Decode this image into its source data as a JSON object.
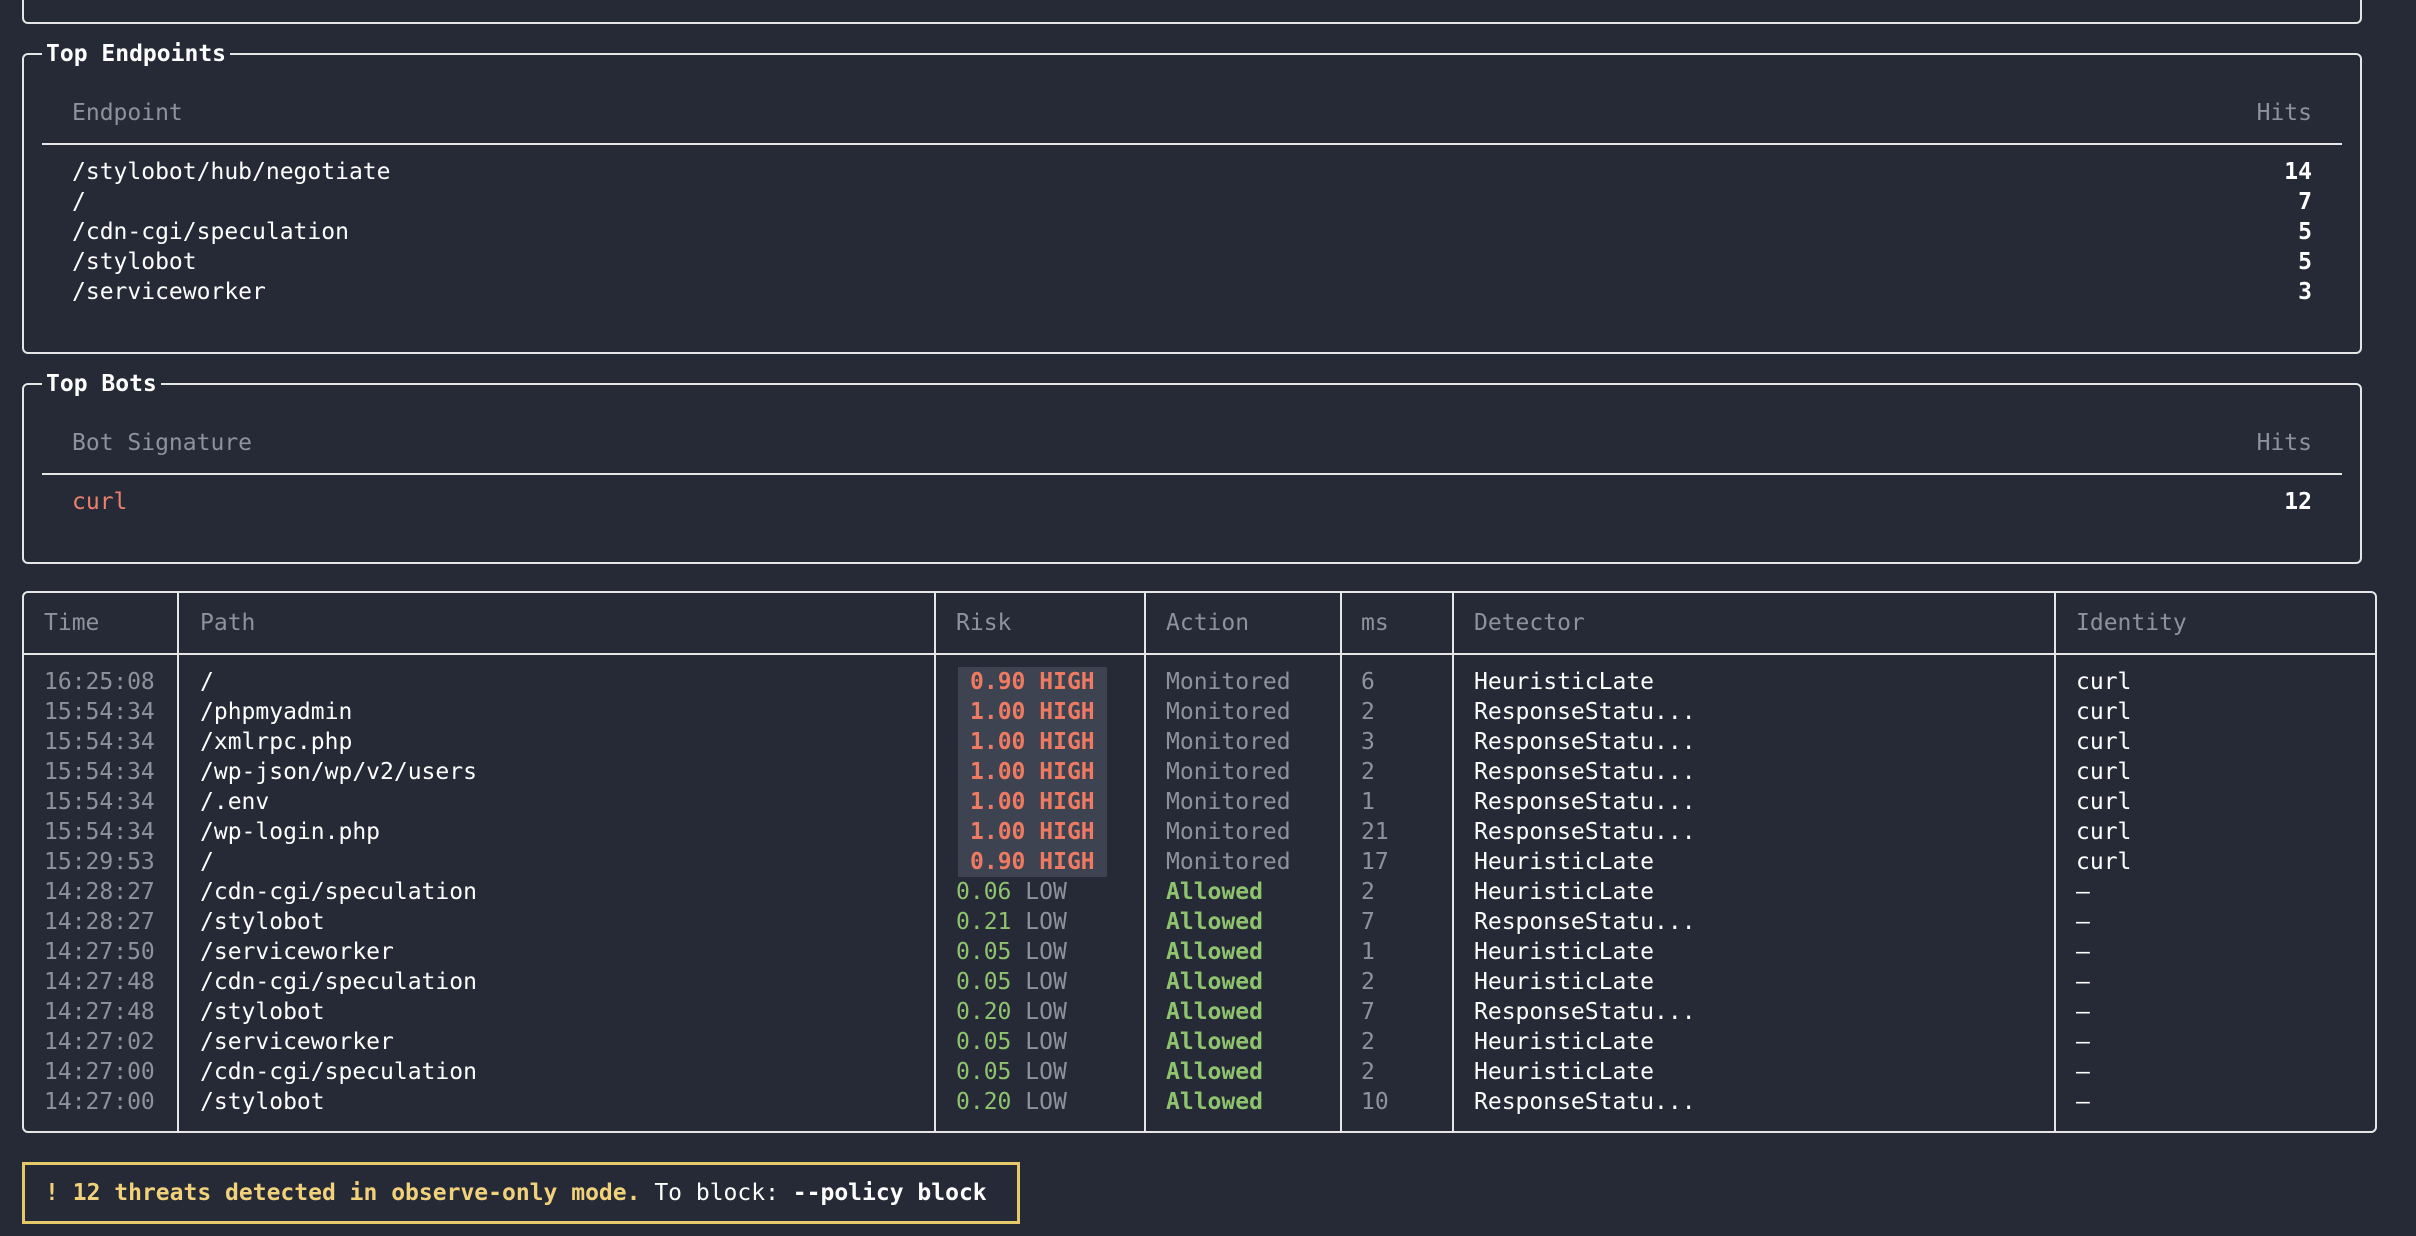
{
  "top_endpoints": {
    "title": "Top Endpoints",
    "col_endpoint": "Endpoint",
    "col_hits": "Hits",
    "rows": [
      {
        "endpoint": "/stylobot/hub/negotiate",
        "hits": "14"
      },
      {
        "endpoint": "/",
        "hits": "7"
      },
      {
        "endpoint": "/cdn-cgi/speculation",
        "hits": "5"
      },
      {
        "endpoint": "/stylobot",
        "hits": "5"
      },
      {
        "endpoint": "/serviceworker",
        "hits": "3"
      }
    ]
  },
  "top_bots": {
    "title": "Top Bots",
    "col_signature": "Bot Signature",
    "col_hits": "Hits",
    "rows": [
      {
        "signature": "curl",
        "hits": "12"
      }
    ]
  },
  "live_table": {
    "headers": {
      "time": "Time",
      "path": "Path",
      "risk": "Risk",
      "action": "Action",
      "ms": "ms",
      "detector": "Detector",
      "identity": "Identity"
    },
    "rows": [
      {
        "time": "16:25:08",
        "path": "/",
        "risk": "0.90",
        "level": "HIGH",
        "action": "Monitored",
        "ms": "6",
        "detector": "HeuristicLate",
        "identity": "curl"
      },
      {
        "time": "15:54:34",
        "path": "/phpmyadmin",
        "risk": "1.00",
        "level": "HIGH",
        "action": "Monitored",
        "ms": "2",
        "detector": "ResponseStatu...",
        "identity": "curl"
      },
      {
        "time": "15:54:34",
        "path": "/xmlrpc.php",
        "risk": "1.00",
        "level": "HIGH",
        "action": "Monitored",
        "ms": "3",
        "detector": "ResponseStatu...",
        "identity": "curl"
      },
      {
        "time": "15:54:34",
        "path": "/wp-json/wp/v2/users",
        "risk": "1.00",
        "level": "HIGH",
        "action": "Monitored",
        "ms": "2",
        "detector": "ResponseStatu...",
        "identity": "curl"
      },
      {
        "time": "15:54:34",
        "path": "/.env",
        "risk": "1.00",
        "level": "HIGH",
        "action": "Monitored",
        "ms": "1",
        "detector": "ResponseStatu...",
        "identity": "curl"
      },
      {
        "time": "15:54:34",
        "path": "/wp-login.php",
        "risk": "1.00",
        "level": "HIGH",
        "action": "Monitored",
        "ms": "21",
        "detector": "ResponseStatu...",
        "identity": "curl"
      },
      {
        "time": "15:29:53",
        "path": "/",
        "risk": "0.90",
        "level": "HIGH",
        "action": "Monitored",
        "ms": "17",
        "detector": "HeuristicLate",
        "identity": "curl"
      },
      {
        "time": "14:28:27",
        "path": "/cdn-cgi/speculation",
        "risk": "0.06",
        "level": "LOW",
        "action": "Allowed",
        "ms": "2",
        "detector": "HeuristicLate",
        "identity": "–"
      },
      {
        "time": "14:28:27",
        "path": "/stylobot",
        "risk": "0.21",
        "level": "LOW",
        "action": "Allowed",
        "ms": "7",
        "detector": "ResponseStatu...",
        "identity": "–"
      },
      {
        "time": "14:27:50",
        "path": "/serviceworker",
        "risk": "0.05",
        "level": "LOW",
        "action": "Allowed",
        "ms": "1",
        "detector": "HeuristicLate",
        "identity": "–"
      },
      {
        "time": "14:27:48",
        "path": "/cdn-cgi/speculation",
        "risk": "0.05",
        "level": "LOW",
        "action": "Allowed",
        "ms": "2",
        "detector": "HeuristicLate",
        "identity": "–"
      },
      {
        "time": "14:27:48",
        "path": "/stylobot",
        "risk": "0.20",
        "level": "LOW",
        "action": "Allowed",
        "ms": "7",
        "detector": "ResponseStatu...",
        "identity": "–"
      },
      {
        "time": "14:27:02",
        "path": "/serviceworker",
        "risk": "0.05",
        "level": "LOW",
        "action": "Allowed",
        "ms": "2",
        "detector": "HeuristicLate",
        "identity": "–"
      },
      {
        "time": "14:27:00",
        "path": "/cdn-cgi/speculation",
        "risk": "0.05",
        "level": "LOW",
        "action": "Allowed",
        "ms": "2",
        "detector": "HeuristicLate",
        "identity": "–"
      },
      {
        "time": "14:27:00",
        "path": "/stylobot",
        "risk": "0.20",
        "level": "LOW",
        "action": "Allowed",
        "ms": "10",
        "detector": "ResponseStatu...",
        "identity": "–"
      }
    ]
  },
  "warning": {
    "bang": "!",
    "message": "12 threats detected in observe-only mode.",
    "hint": "To block:",
    "flag": "--policy block"
  },
  "colors": {
    "background": "#262a36",
    "high": "#ef7a62",
    "low": "#8fc46f",
    "warning": "#e4c86a"
  }
}
